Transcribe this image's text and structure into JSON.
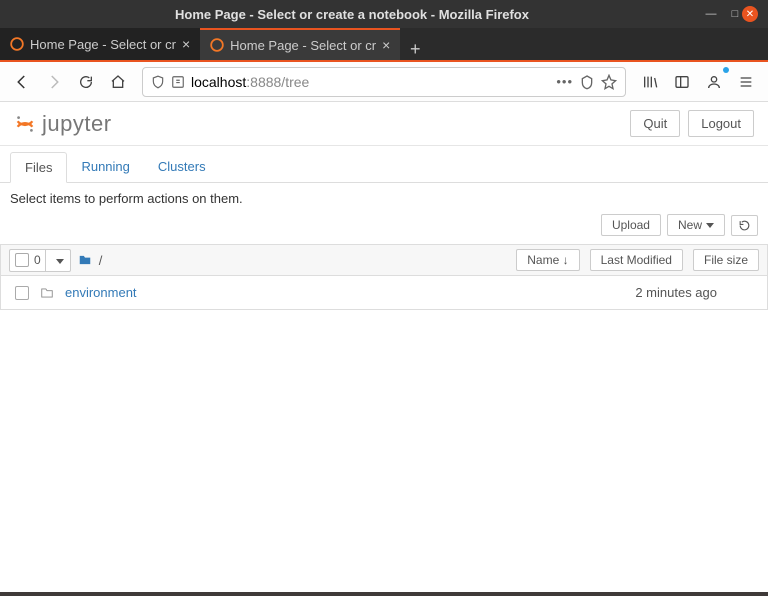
{
  "window": {
    "title": "Home Page - Select or create a notebook - Mozilla Firefox"
  },
  "tabs": [
    {
      "label": "Home Page - Select or cr"
    },
    {
      "label": "Home Page - Select or cr"
    }
  ],
  "url": {
    "host": "localhost",
    "rest": ":8888/tree"
  },
  "jupyter": {
    "brand": "jupyter",
    "quit": "Quit",
    "logout": "Logout",
    "tabs": {
      "files": "Files",
      "running": "Running",
      "clusters": "Clusters"
    },
    "hint": "Select items to perform actions on them.",
    "upload": "Upload",
    "new": "New",
    "sel_count": "0",
    "crumb_root": "/",
    "cols": {
      "name": "Name",
      "last_modified": "Last Modified",
      "file_size": "File size"
    },
    "rows": [
      {
        "name": "environment",
        "last_modified": "2 minutes ago",
        "size": ""
      }
    ]
  }
}
